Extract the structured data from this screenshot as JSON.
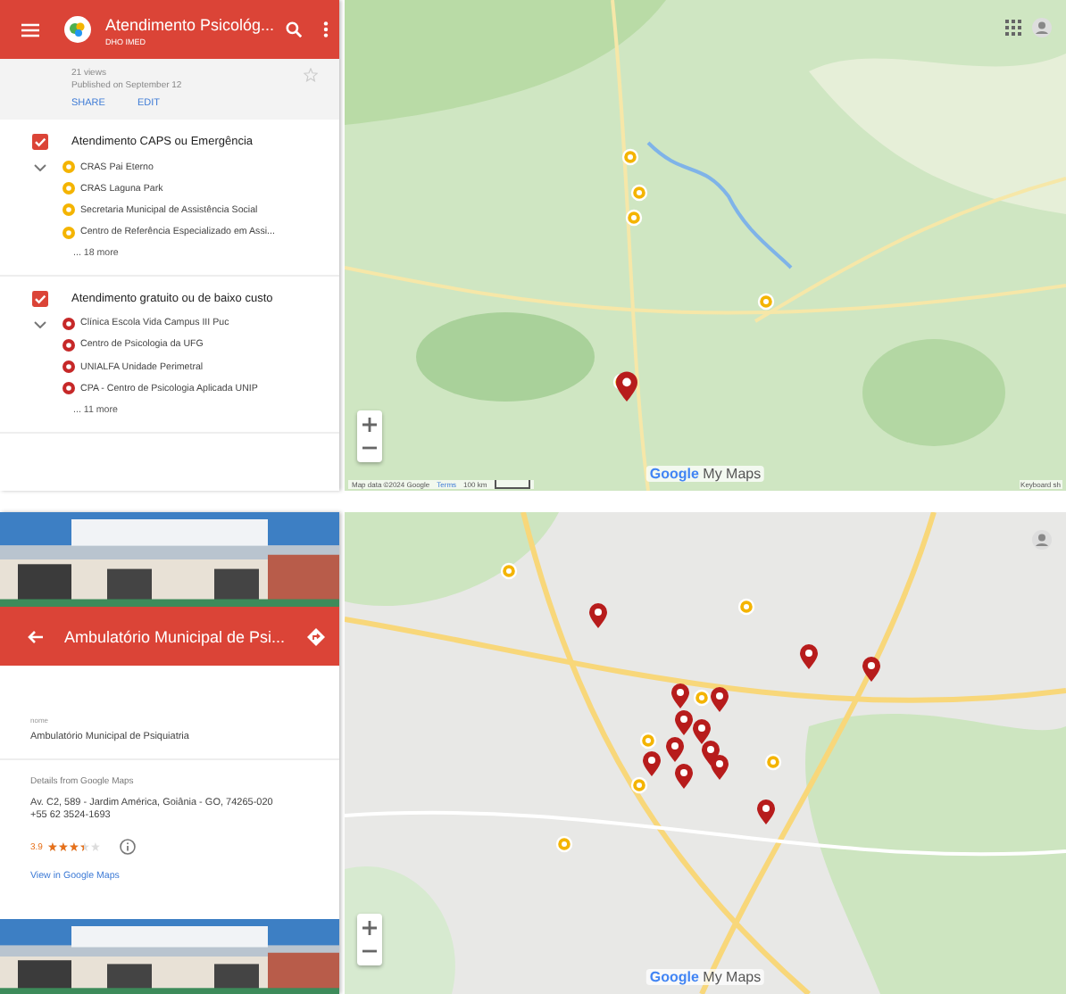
{
  "top_view": {
    "header": {
      "title": "Atendimento Psicológ...",
      "subtitle": "DHO IMED"
    },
    "meta": {
      "views": "21 views",
      "published": "Published on September 12",
      "actions": [
        "SHARE",
        "EDIT"
      ]
    },
    "layers": [
      {
        "title": "Atendimento CAPS ou Emergência",
        "checked": true,
        "expanded": true,
        "color": "#f4b400",
        "items": [
          "CRAS Pai Eterno",
          "CRAS Laguna Park",
          "Secretaria Municipal de Assistência Social",
          "Centro de Referência Especializado em Assi..."
        ],
        "more": "... 18 more"
      },
      {
        "title": "Atendimento gratuito ou de baixo custo",
        "checked": true,
        "expanded": true,
        "color": "#c62828",
        "items": [
          "Clínica Escola Vida Campus III Puc",
          "Centro de Psicologia da UFG",
          "UNIALFA Unidade Perimetral",
          "CPA - Centro de Psicologia Aplicada UNIP"
        ],
        "more": "... 11 more"
      }
    ],
    "map": {
      "kind": "region",
      "logo": [
        "Google",
        "My Maps"
      ],
      "attribution": [
        "Map data ©2024 Google",
        "Terms",
        "100 km"
      ],
      "shortcuts": "Keyboard sh"
    }
  },
  "bottom_view": {
    "place": {
      "title": "Ambulatório Municipal de Psi...",
      "field_label": "nome",
      "field_value": "Ambulatório Municipal de Psiquiatria",
      "details_heading": "Details from Google Maps",
      "address": "Av. C2, 589 - Jardim América, Goiânia - GO, 74265-020",
      "phone": "+55 62 3524-1693",
      "rating": "3.9",
      "stars": 3.5,
      "link": "View in Google Maps"
    },
    "map": {
      "kind": "city",
      "logo": [
        "Google",
        "My Maps"
      ]
    }
  }
}
